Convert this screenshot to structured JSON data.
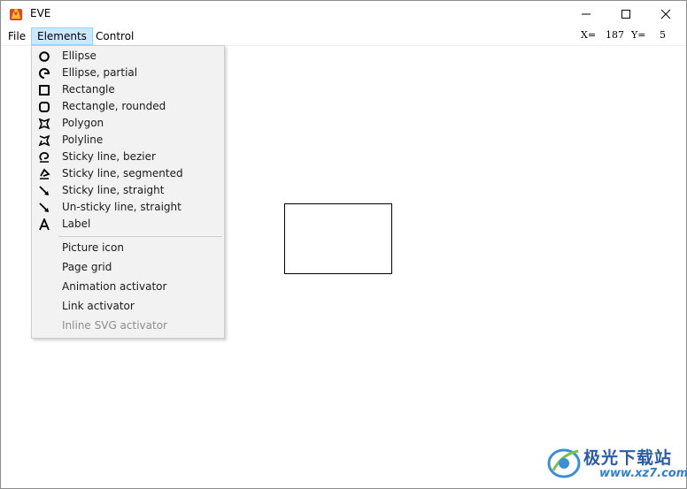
{
  "window": {
    "title": "EVE"
  },
  "menubar": {
    "file": "File",
    "elements": "Elements",
    "control": "Control"
  },
  "coords": {
    "x_label": "X=",
    "x_value": "187",
    "y_label": "Y=",
    "y_value": "5"
  },
  "elements_menu": {
    "items": [
      {
        "label": "Ellipse",
        "icon": "ellipse-icon",
        "enabled": true
      },
      {
        "label": "Ellipse, partial",
        "icon": "ellipse-partial-icon",
        "enabled": true
      },
      {
        "label": "Rectangle",
        "icon": "rectangle-icon",
        "enabled": true
      },
      {
        "label": "Rectangle, rounded",
        "icon": "rectangle-rounded-icon",
        "enabled": true
      },
      {
        "label": "Polygon",
        "icon": "polygon-icon",
        "enabled": true
      },
      {
        "label": "Polyline",
        "icon": "polyline-icon",
        "enabled": true
      },
      {
        "label": "Sticky line, bezier",
        "icon": "sticky-bezier-icon",
        "enabled": true
      },
      {
        "label": "Sticky line, segmented",
        "icon": "sticky-segmented-icon",
        "enabled": true
      },
      {
        "label": "Sticky line, straight",
        "icon": "sticky-straight-icon",
        "enabled": true
      },
      {
        "label": "Un-sticky line, straight",
        "icon": "unsticky-straight-icon",
        "enabled": true
      },
      {
        "label": "Label",
        "icon": "label-icon",
        "enabled": true
      }
    ],
    "extra_items": [
      {
        "label": "Picture icon",
        "enabled": true
      },
      {
        "label": "Page grid",
        "enabled": true
      },
      {
        "label": "Animation activator",
        "enabled": true
      },
      {
        "label": "Link activator",
        "enabled": true
      },
      {
        "label": "Inline SVG activator",
        "enabled": false
      }
    ]
  },
  "watermark": {
    "text": "极光下载站",
    "url": "www.xz7.com",
    "color": "#2a5caa"
  }
}
